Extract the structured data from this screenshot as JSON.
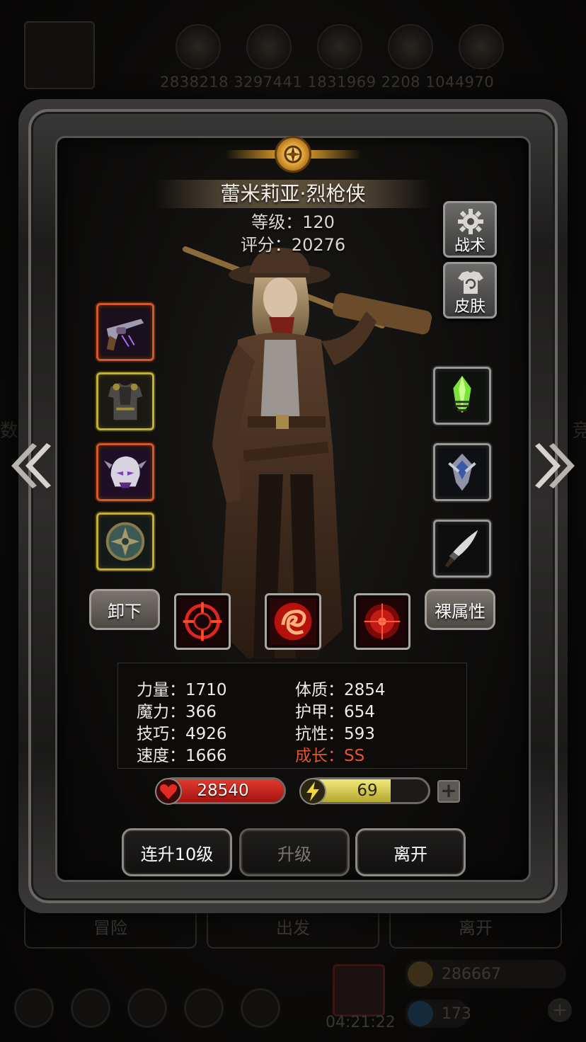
{
  "background": {
    "resource_values": "2838218  3297441 1831969  2208  1044970",
    "left_side_text": "数争",
    "right_side_text": "竞",
    "bottom_buttons": [
      "冒险",
      "出发",
      "离开"
    ],
    "gold_amount": "286667",
    "gem_amount": "173",
    "timer": "04:21:22"
  },
  "hero": {
    "name": "蕾米莉亚·烈枪侠",
    "level_text": "等级：120",
    "score_text": "评分：20276"
  },
  "side_buttons": {
    "tactics": "战术",
    "skin": "皮肤"
  },
  "equipment": {
    "left": [
      {
        "icon": "revolver-icon",
        "quality": "red"
      },
      {
        "icon": "armor-icon",
        "quality": "gold"
      },
      {
        "icon": "helmet-icon",
        "quality": "red"
      },
      {
        "icon": "shield-icon",
        "quality": "gold"
      }
    ],
    "right": [
      {
        "icon": "green-crystal-icon",
        "quality": "silver"
      },
      {
        "icon": "badge-icon",
        "quality": "silver"
      },
      {
        "icon": "dagger-icon",
        "quality": "silver"
      }
    ]
  },
  "buttons": {
    "unequip": "卸下",
    "base_attributes": "裸属性",
    "level_up_10": "连升10级",
    "level_up": "升级",
    "leave": "离开"
  },
  "skills": [
    "crosshair-ring-icon",
    "fire-swirl-icon",
    "target-burst-icon"
  ],
  "stats": {
    "strength": "力量：1710",
    "magic": "魔力：366",
    "skill": "技巧：4926",
    "speed": "速度：1666",
    "constitution": "体质：2854",
    "armor": "护甲：654",
    "resistance": "抗性：593",
    "growth": "成长：SS"
  },
  "bars": {
    "hp": "28540",
    "hp_fill": 1.0,
    "energy": "69",
    "energy_fill": 0.69
  },
  "colors": {
    "growth": "#e4572f",
    "hp": "#c8201c",
    "energy": "#d8d05a"
  }
}
